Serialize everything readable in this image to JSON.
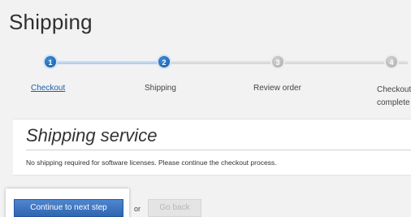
{
  "page": {
    "title": "Shipping"
  },
  "stepper": {
    "steps": [
      {
        "number": "1",
        "label": "Checkout",
        "state": "completed-link"
      },
      {
        "number": "2",
        "label": "Shipping",
        "state": "current"
      },
      {
        "number": "3",
        "label": "Review order",
        "state": "upcoming"
      },
      {
        "number": "4",
        "label_line1": "Checkout",
        "label_line2": "complete",
        "state": "upcoming"
      }
    ]
  },
  "shipping_service": {
    "heading": "Shipping service",
    "message": "No shipping required for software licenses. Please continue the checkout process."
  },
  "actions": {
    "continue_label": "Continue to next step",
    "or_label": "or",
    "back_label": "Go back"
  },
  "colors": {
    "accent": "#2f65b1",
    "link": "#1f5ea8",
    "step_active": "#15589f",
    "step_inactive": "#a9a9a9"
  }
}
